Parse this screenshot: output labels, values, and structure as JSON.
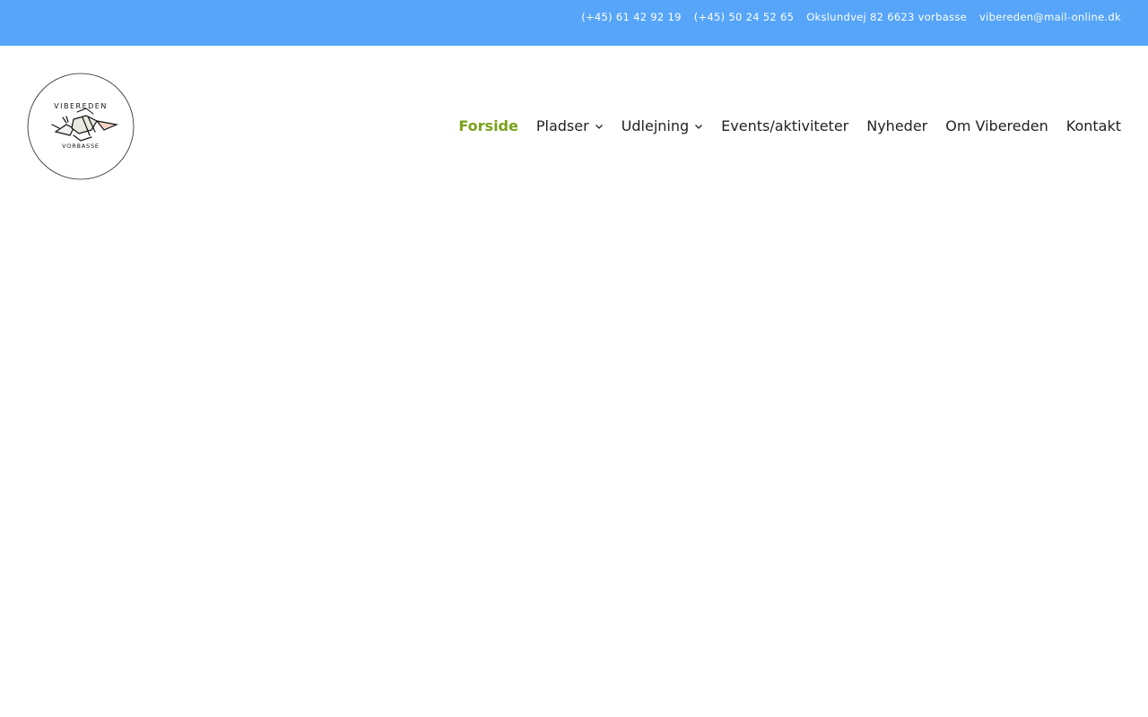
{
  "topbar": {
    "background": "#56a5f8",
    "phone1": "(+45) 61 42 92 19",
    "phone2": "(+45) 50 24 52 65",
    "address": "Okslundvej 82 6623 vorbasse",
    "email": "vibereden@mail-online.dk"
  },
  "logo": {
    "text_top": "VIBEREDEN",
    "text_bottom": "VORBASSE"
  },
  "nav": {
    "active_color": "#7aa11b",
    "items": [
      {
        "label": "Forside",
        "active": true
      },
      {
        "label": "Pladser",
        "dropdown": true,
        "icon": "chevron-down-icon"
      },
      {
        "label": "Udlejning",
        "dropdown": true,
        "icon": "chevron-down-icon"
      },
      {
        "label": "Events/aktiviteter"
      },
      {
        "label": "Nyheder"
      },
      {
        "label": "Om Vibereden"
      },
      {
        "label": "Kontakt"
      }
    ]
  }
}
